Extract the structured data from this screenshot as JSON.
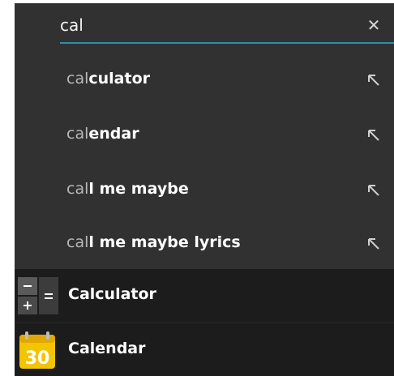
{
  "search": {
    "value": "cal",
    "clear_glyph": "✕"
  },
  "suggestions": [
    {
      "query": "cal",
      "rest": "culator",
      "icon": "arrow-up-left-icon"
    },
    {
      "query": "cal",
      "rest": "endar",
      "icon": "arrow-up-left-icon"
    },
    {
      "query": "cal",
      "rest": "l me maybe",
      "icon": "arrow-up-left-icon"
    },
    {
      "query": "cal",
      "rest": "l me maybe lyrics",
      "icon": "arrow-up-left-icon"
    }
  ],
  "apps": [
    {
      "label": "Calculator",
      "icon": "calculator-icon"
    },
    {
      "label": "Calendar",
      "icon": "calendar-icon",
      "icon_text": "30"
    }
  ],
  "colors": {
    "background": "#313131",
    "apps_background": "#1c1c1c",
    "accent": "#2f8eaa"
  }
}
